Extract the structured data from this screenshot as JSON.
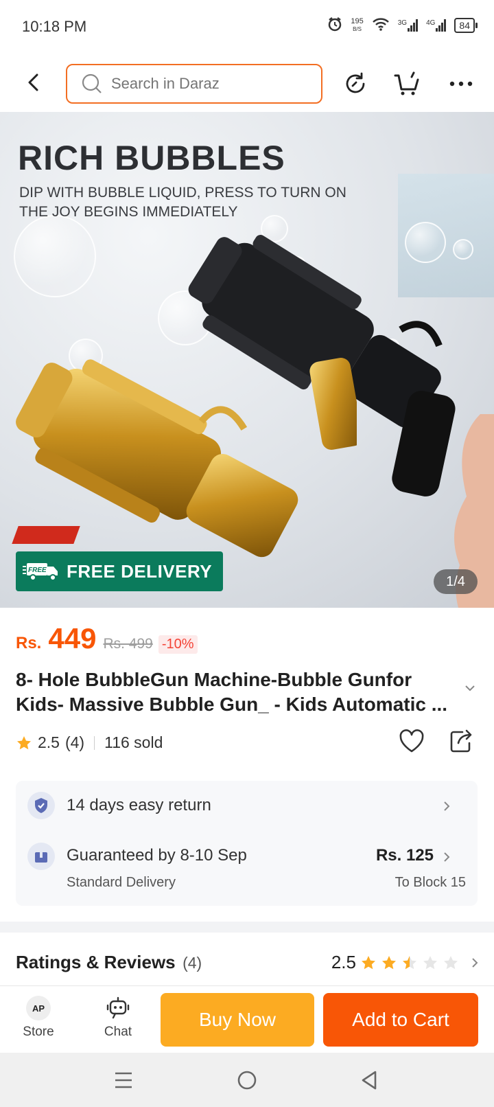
{
  "status_bar": {
    "time": "10:18 PM",
    "net_speed": "195",
    "net_unit": "B/S",
    "sim1": "3G",
    "sim2": "4G",
    "battery": "84"
  },
  "header": {
    "search_placeholder": "Search in Daraz",
    "icons": [
      "back-arrow-icon",
      "search-icon",
      "history-refresh-icon",
      "cart-icon",
      "more-icon"
    ]
  },
  "gallery": {
    "headline": "RICH BUBBLES",
    "subhead_line1": "DIP WITH BUBBLE LIQUID, PRESS TO TURN ON",
    "subhead_line2": "THE JOY BEGINS IMMEDIATELY",
    "badge_small": "FREE",
    "badge_text": "FREE DELIVERY",
    "page_counter": "1/4"
  },
  "product": {
    "currency": "Rs.",
    "price": "449",
    "old_price": "Rs. 499",
    "discount": "-10%",
    "title": "8- Hole BubbleGun Machine-Bubble Gunfor Kids- Massive Bubble Gun_ - Kids Automatic ...",
    "rating": "2.5",
    "rating_count": "(4)",
    "sold": "116 sold"
  },
  "services": {
    "return_text": "14 days easy return",
    "delivery_text": "Guaranteed by 8-10 Sep",
    "delivery_sub": "Standard Delivery",
    "delivery_fee": "Rs. 125",
    "delivery_location": "To Block 15"
  },
  "reviews": {
    "title": "Ratings & Reviews",
    "count": "(4)",
    "score": "2.5",
    "stars_filled_fraction": 0.5
  },
  "bottom_bar": {
    "store_label": "Store",
    "store_logo": "AP",
    "chat_label": "Chat",
    "buy_now": "Buy Now",
    "add_to_cart": "Add to Cart"
  },
  "colors": {
    "accent": "#f85606",
    "buy_now": "#fcab22",
    "free_delivery": "#0b7b5c",
    "star": "#fcab22"
  }
}
